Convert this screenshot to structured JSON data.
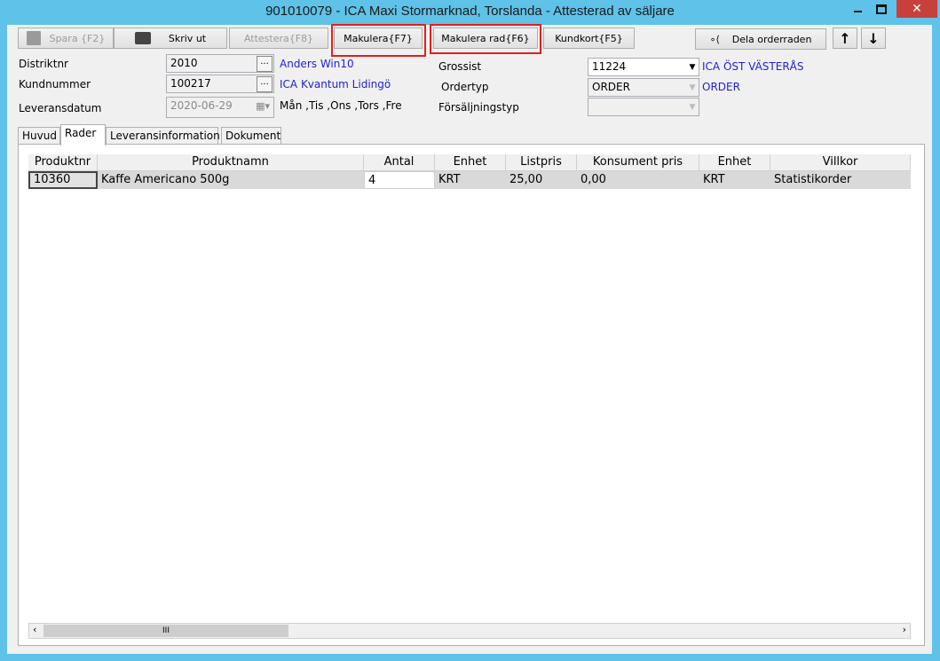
{
  "window": {
    "title": "901010079 - ICA Maxi Stormarknad, Torslanda - Attesterad av säljare"
  },
  "toolbar": {
    "save": "Spara {F2}",
    "print": "Skriv ut",
    "attest": "Attestera{F8}",
    "makulera": "Makulera{F7}",
    "makulera_rad": "Makulera rad{F6}",
    "kundkort": "Kundkort{F5}",
    "dela": "Dela orderraden"
  },
  "form": {
    "distrikt_label": "Distriktnr",
    "distrikt_value": "2010",
    "distrikt_name": "Anders Win10",
    "kund_label": "Kundnummer",
    "kund_value": "100217",
    "kund_name": "ICA Kvantum Lidingö",
    "leverans_label": "Leveransdatum",
    "leverans_value": "2020-06-29",
    "leverans_days": "Mån ,Tis ,Ons ,Tors ,Fre",
    "grossist_label": "Grossist",
    "grossist_value": "11224",
    "grossist_name": "ICA ÖST VÄSTERÅS",
    "ordertyp_label": "Ordertyp",
    "ordertyp_value": "ORDER",
    "ordertyp_name": "ORDER",
    "forsaljning_label": "Försäljningstyp",
    "forsaljning_value": ""
  },
  "tabs": [
    "Huvud",
    "Rader",
    "Leveransinformation",
    "Dokument"
  ],
  "table": {
    "headers": [
      "Produktnr",
      "Produktnamn",
      "Antal",
      "Enhet",
      "Listpris",
      "Konsument pris",
      "Enhet",
      "Villkor"
    ],
    "rows": [
      [
        "10360",
        "Kaffe Americano 500g",
        "4",
        "KRT",
        "25,00",
        "0,00",
        "KRT",
        "Statistikorder"
      ]
    ]
  },
  "scrollbar": {
    "thumb": "III"
  }
}
